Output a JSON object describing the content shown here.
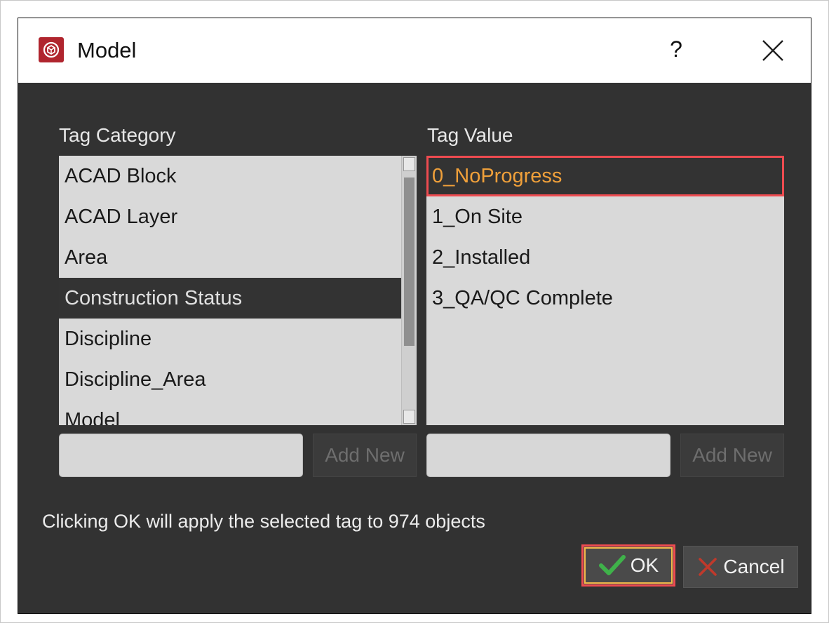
{
  "window": {
    "title": "Model",
    "help_label": "?",
    "close_icon": "close-icon",
    "app_icon": "model-app-icon",
    "brand_color": "#b0252e"
  },
  "tag_category": {
    "label": "Tag Category",
    "items": [
      "ACAD Block",
      "ACAD Layer",
      "Area",
      "Construction Status",
      "Discipline",
      "Discipline_Area",
      "Model"
    ],
    "selected": "Construction Status",
    "new_value": "",
    "add_label": "Add New"
  },
  "tag_value": {
    "label": "Tag Value",
    "items": [
      "0_NoProgress",
      "1_On Site",
      "2_Installed",
      "3_QA/QC Complete"
    ],
    "selected": "0_NoProgress",
    "new_value": "",
    "add_label": "Add New"
  },
  "info_text": "Clicking OK will apply the selected tag to 974 objects",
  "buttons": {
    "ok_label": "OK",
    "cancel_label": "Cancel",
    "ok_icon": "check-icon",
    "cancel_icon": "x-icon"
  },
  "colors": {
    "highlight_border": "#ee4b50",
    "selected_text": "#f0a03a",
    "ok_check": "#3fb24a",
    "cancel_x": "#c0392b"
  }
}
